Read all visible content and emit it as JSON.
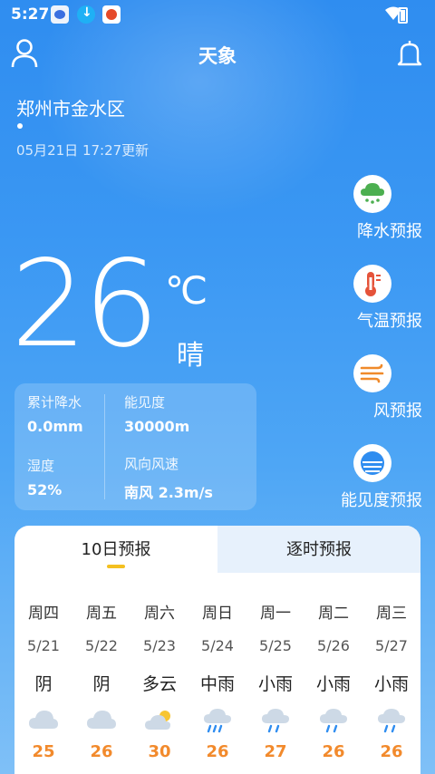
{
  "status_bar": {
    "time": "5:27"
  },
  "header": {
    "title": "天象"
  },
  "location": {
    "name": "郑州市金水区",
    "updated": "05月21日 17:27更新"
  },
  "current": {
    "temperature": "26",
    "unit": "℃",
    "condition": "晴",
    "details": [
      {
        "label": "累计降水",
        "value": "0.0mm"
      },
      {
        "label": "能见度",
        "value": "30000m"
      },
      {
        "label": "湿度",
        "value": "52%"
      },
      {
        "label": "风向风速",
        "value": "南风 2.3m/s"
      }
    ]
  },
  "side_menu": [
    {
      "label": "降水预报",
      "icon": "rain-cloud-icon",
      "color": "#4caf50"
    },
    {
      "label": "气温预报",
      "icon": "thermometer-icon",
      "color": "#e5533a"
    },
    {
      "label": "风预报",
      "icon": "wind-icon",
      "color": "#f08a2a"
    },
    {
      "label": "能见度预报",
      "icon": "visibility-icon",
      "color": "#2f8df0"
    }
  ],
  "forecast": {
    "tabs": [
      "10日预报",
      "逐时预报"
    ],
    "active_tab": "10日预报",
    "days": [
      {
        "week": "周四",
        "date": "5/21",
        "cond": "阴",
        "icon": "overcast-icon",
        "high": "25"
      },
      {
        "week": "周五",
        "date": "5/22",
        "cond": "阴",
        "icon": "overcast-icon",
        "high": "26"
      },
      {
        "week": "周六",
        "date": "5/23",
        "cond": "多云",
        "icon": "partly-cloudy-icon",
        "high": "30"
      },
      {
        "week": "周日",
        "date": "5/24",
        "cond": "中雨",
        "icon": "moderate-rain-icon",
        "high": "26"
      },
      {
        "week": "周一",
        "date": "5/25",
        "cond": "小雨",
        "icon": "light-rain-icon",
        "high": "27"
      },
      {
        "week": "周二",
        "date": "5/26",
        "cond": "小雨",
        "icon": "light-rain-icon",
        "high": "26"
      },
      {
        "week": "周三",
        "date": "5/27",
        "cond": "小雨",
        "icon": "light-rain-icon",
        "high": "26"
      }
    ]
  },
  "colors": {
    "background_top": "#2f8df0",
    "accent_high_temp": "#f28a2c",
    "tab_indicator": "#f4c020"
  }
}
